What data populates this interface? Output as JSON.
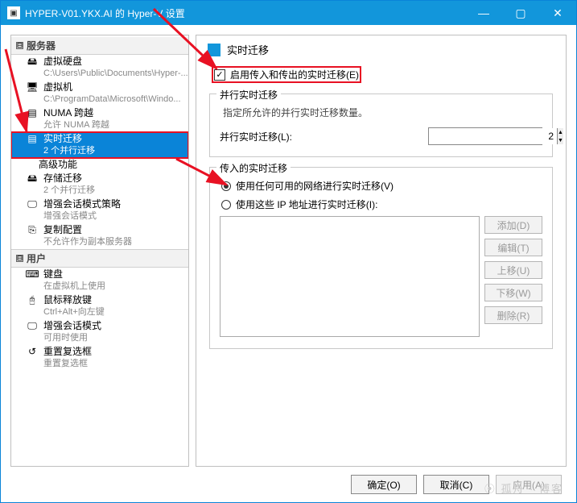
{
  "window": {
    "title": "HYPER-V01.YKX.AI 的 Hyper-V 设置",
    "min": "—",
    "max": "▢",
    "close": "✕"
  },
  "tree": {
    "server_hdr": "服务器",
    "user_hdr": "用户",
    "caret_server": "⊟",
    "caret_user": "⊟",
    "items": [
      {
        "icon": "🖴",
        "label": "虚拟硬盘",
        "sub": "C:\\Users\\Public\\Documents\\Hyper-..."
      },
      {
        "icon": "🖥",
        "label": "虚拟机",
        "sub": "C:\\ProgramData\\Microsoft\\Windo..."
      },
      {
        "icon": "▤",
        "label": "NUMA 跨越",
        "sub": "允许 NUMA 跨越"
      },
      {
        "icon": "▤",
        "label": "实时迁移",
        "sub": "2 个并行迁移",
        "sel": true,
        "boxed": true,
        "children": [
          {
            "label": "高级功能"
          }
        ]
      },
      {
        "icon": "🖴",
        "label": "存储迁移",
        "sub": "2 个并行迁移"
      },
      {
        "icon": "🖵",
        "label": "增强会话模式策略",
        "sub": "增强会话模式"
      },
      {
        "icon": "⎘",
        "label": "复制配置",
        "sub": "不允许作为副本服务器"
      }
    ],
    "user_items": [
      {
        "icon": "⌨",
        "label": "键盘",
        "sub": "在虚拟机上使用"
      },
      {
        "icon": "🖰",
        "label": "鼠标释放键",
        "sub": "Ctrl+Alt+向左键"
      },
      {
        "icon": "🖵",
        "label": "增强会话模式",
        "sub": "可用时使用"
      },
      {
        "icon": "↺",
        "label": "重置复选框",
        "sub": "重置复选框"
      }
    ]
  },
  "right": {
    "heading": "实时迁移",
    "enable_label": "启用传入和传出的实时迁移(E)",
    "grp1_legend": "并行实时迁移",
    "grp1_desc": "指定所允许的并行实时迁移数量。",
    "grp1_field": "并行实时迁移(L):",
    "grp1_value": "2",
    "grp2_legend": "传入的实时迁移",
    "radio1": "使用任何可用的网络进行实时迁移(V)",
    "radio2": "使用这些 IP 地址进行实时迁移(I):",
    "btn_add": "添加(D)",
    "btn_edit": "编辑(T)",
    "btn_up": "上移(U)",
    "btn_down": "下移(W)",
    "btn_del": "删除(R)"
  },
  "footer": {
    "ok": "确定(O)",
    "cancel": "取消(C)",
    "apply": "应用(A)"
  },
  "watermark": "⦿ 孤舟 · 博客"
}
